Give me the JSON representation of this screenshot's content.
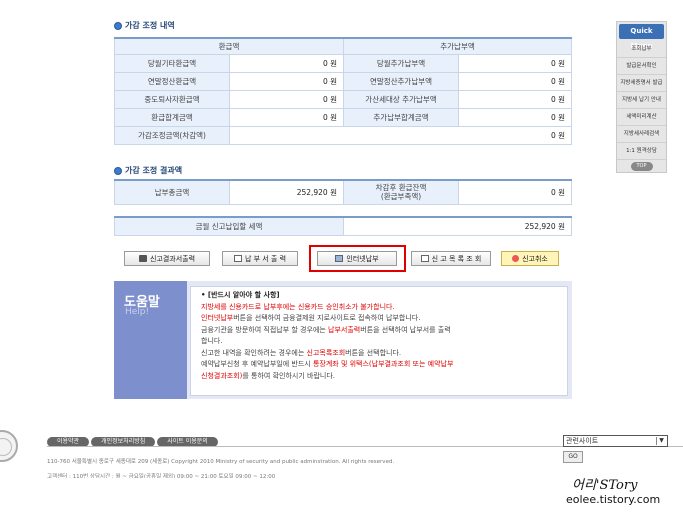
{
  "section1": {
    "title": "가감 조정 내역"
  },
  "table1": {
    "header_left": "환급액",
    "header_right": "추가납부액",
    "rows": [
      {
        "l_label": "당월기타환급액",
        "l_value": "0 원",
        "r_label": "당월추가납부액",
        "r_value": "0 원"
      },
      {
        "l_label": "연말정산환급액",
        "l_value": "0 원",
        "r_label": "연말정산추가납부액",
        "r_value": "0 원"
      },
      {
        "l_label": "중도퇴사자환급액",
        "l_value": "0 원",
        "r_label": "가산세대상 추가납부액",
        "r_value": "0 원"
      },
      {
        "l_label": "환급합계금액",
        "l_value": "0 원",
        "r_label": "추가납부합계금액",
        "r_value": "0 원"
      }
    ],
    "adjust_label": "가감조정금액(차감액)",
    "adjust_value": "0 원"
  },
  "section2": {
    "title": "가감 조정 결과액"
  },
  "table2": {
    "total_label": "납부총금액",
    "total_value": "252,920 원",
    "balance_label_1": "차감후 환급잔액",
    "balance_label_2": "(환급부족액)",
    "balance_value": "0 원"
  },
  "table3": {
    "label": "금월 신고납입할 세액",
    "value": "252,920 원"
  },
  "buttons": {
    "print_result": "신고결과서출력",
    "print_payment": "납 부 서 출 력",
    "internet_pay": "인터넷납부",
    "report_list": "신 고 목 록 조 회",
    "cancel_report": "신고취소"
  },
  "help": {
    "side_title": "도움말",
    "side_sub": "Help!",
    "heading": "• [반드시 알아야 할 사항]",
    "line1": "지방세를 신용카드로 납부후에는 신용카드 승인취소가 불가합니다.",
    "line2a": "인터넷납부",
    "line2b": "버튼을 선택하여 금융결제원 지로사이트로 접속하여 납부합니다.",
    "line3a": "금융기관을 방문하여 직접납부 할 경우에는 ",
    "line3b": "납부서출력",
    "line3c": "버튼을 선택하여 납부서를 출력",
    "line4": "합니다.",
    "line5a": "신고한 내역을 확인하려는 경우에는 ",
    "line5b": "신고목록조회",
    "line5c": "버튼을 선택합니다.",
    "line6a": "예약납부신청 후 예약납부일에 반드시 ",
    "line6b": "통장계좌 및 위택스(납부결과조회 또는 예약납부",
    "line7a": "신청결과조회)",
    "line7b": "를 통하여 확인하시기 바랍니다."
  },
  "quick_menu": {
    "title": "Quick Menu",
    "items": [
      "조회납부",
      "발급문서확인",
      "지방세증명서 발급",
      "지방세 납기 안내",
      "세액미리계산",
      "지방세사례검색",
      "1:1 원격상담"
    ],
    "top": "TOP"
  },
  "footer": {
    "links": [
      "이용약관",
      "개인정보처리방침",
      "사이트 이용문의"
    ],
    "address": "110-760 서울특별시 종로구 세종대로 209 (세종로)  Copyright 2010 Ministry of security and public adminstration. All rights reserved.",
    "address2": "고객센터 : 110번    상담시간 : 월 ~ 금요일(공휴일 제외) 09:00 ~ 21:00    토요일 09:00 ~ 12:00",
    "related_select": "관련사이트",
    "go": "GO"
  },
  "watermark": {
    "line1": "어리'STory",
    "line2": "eolee.tistory.com"
  }
}
